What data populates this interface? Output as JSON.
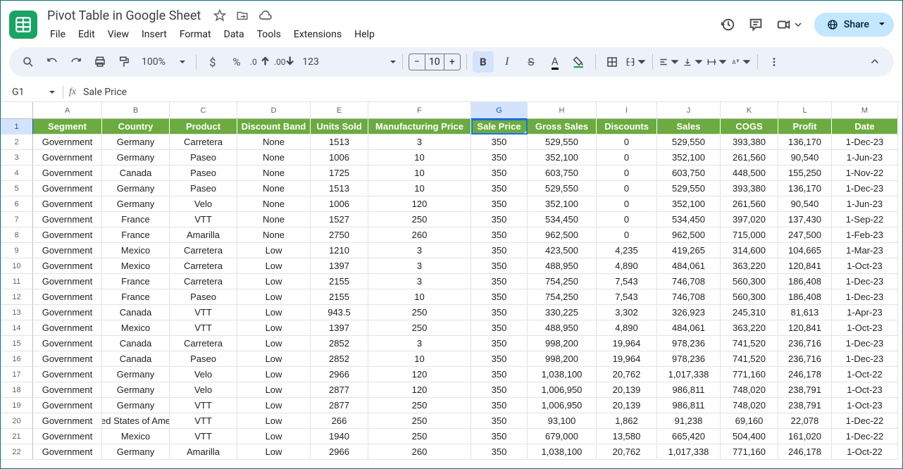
{
  "doc": {
    "title": "Pivot Table in Google Sheet"
  },
  "menus": [
    "File",
    "Edit",
    "View",
    "Insert",
    "Format",
    "Data",
    "Tools",
    "Extensions",
    "Help"
  ],
  "share_label": "Share",
  "zoom": "100%",
  "number_format": "123",
  "font_size": "10",
  "namebox": "G1",
  "formula": "Sale Price",
  "colLetters": [
    "A",
    "B",
    "C",
    "D",
    "E",
    "F",
    "G",
    "H",
    "I",
    "J",
    "K",
    "L",
    "M"
  ],
  "selectedCol": 6,
  "selectedRow": 0,
  "headers": [
    "Segment",
    "Country",
    "Product",
    "Discount Band",
    "Units Sold",
    "Manufacturing Price",
    "Sale Price",
    "Gross Sales",
    "Discounts",
    "Sales",
    "COGS",
    "Profit",
    "Date"
  ],
  "rows": [
    [
      "Government",
      "Germany",
      "Carretera",
      "None",
      "1513",
      "3",
      "350",
      "529,550",
      "0",
      "529,550",
      "393,380",
      "136,170",
      "1-Dec-23"
    ],
    [
      "Government",
      "Germany",
      "Paseo",
      "None",
      "1006",
      "10",
      "350",
      "352,100",
      "0",
      "352,100",
      "261,560",
      "90,540",
      "1-Jun-23"
    ],
    [
      "Government",
      "Canada",
      "Paseo",
      "None",
      "1725",
      "10",
      "350",
      "603,750",
      "0",
      "603,750",
      "448,500",
      "155,250",
      "1-Nov-22"
    ],
    [
      "Government",
      "Germany",
      "Paseo",
      "None",
      "1513",
      "10",
      "350",
      "529,550",
      "0",
      "529,550",
      "393,380",
      "136,170",
      "1-Dec-23"
    ],
    [
      "Government",
      "Germany",
      "Velo",
      "None",
      "1006",
      "120",
      "350",
      "352,100",
      "0",
      "352,100",
      "261,560",
      "90,540",
      "1-Jun-23"
    ],
    [
      "Government",
      "France",
      "VTT",
      "None",
      "1527",
      "250",
      "350",
      "534,450",
      "0",
      "534,450",
      "397,020",
      "137,430",
      "1-Sep-22"
    ],
    [
      "Government",
      "France",
      "Amarilla",
      "None",
      "2750",
      "260",
      "350",
      "962,500",
      "0",
      "962,500",
      "715,000",
      "247,500",
      "1-Feb-23"
    ],
    [
      "Government",
      "Mexico",
      "Carretera",
      "Low",
      "1210",
      "3",
      "350",
      "423,500",
      "4,235",
      "419,265",
      "314,600",
      "104,665",
      "1-Mar-23"
    ],
    [
      "Government",
      "Mexico",
      "Carretera",
      "Low",
      "1397",
      "3",
      "350",
      "488,950",
      "4,890",
      "484,061",
      "363,220",
      "120,841",
      "1-Oct-23"
    ],
    [
      "Government",
      "France",
      "Carretera",
      "Low",
      "2155",
      "3",
      "350",
      "754,250",
      "7,543",
      "746,708",
      "560,300",
      "186,408",
      "1-Dec-23"
    ],
    [
      "Government",
      "France",
      "Paseo",
      "Low",
      "2155",
      "10",
      "350",
      "754,250",
      "7,543",
      "746,708",
      "560,300",
      "186,408",
      "1-Dec-23"
    ],
    [
      "Government",
      "Canada",
      "VTT",
      "Low",
      "943.5",
      "250",
      "350",
      "330,225",
      "3,302",
      "326,923",
      "245,310",
      "81,613",
      "1-Apr-23"
    ],
    [
      "Government",
      "Mexico",
      "VTT",
      "Low",
      "1397",
      "250",
      "350",
      "488,950",
      "4,890",
      "484,061",
      "363,220",
      "120,841",
      "1-Oct-23"
    ],
    [
      "Government",
      "Canada",
      "Carretera",
      "Low",
      "2852",
      "3",
      "350",
      "998,200",
      "19,964",
      "978,236",
      "741,520",
      "236,716",
      "1-Dec-23"
    ],
    [
      "Government",
      "Canada",
      "Paseo",
      "Low",
      "2852",
      "10",
      "350",
      "998,200",
      "19,964",
      "978,236",
      "741,520",
      "236,716",
      "1-Dec-23"
    ],
    [
      "Government",
      "Germany",
      "Velo",
      "Low",
      "2966",
      "120",
      "350",
      "1,038,100",
      "20,762",
      "1,017,338",
      "771,160",
      "246,178",
      "1-Oct-22"
    ],
    [
      "Government",
      "Germany",
      "Velo",
      "Low",
      "2877",
      "120",
      "350",
      "1,006,950",
      "20,139",
      "986,811",
      "748,020",
      "238,791",
      "1-Oct-23"
    ],
    [
      "Government",
      "Germany",
      "VTT",
      "Low",
      "2877",
      "250",
      "350",
      "1,006,950",
      "20,139",
      "986,811",
      "748,020",
      "238,791",
      "1-Oct-23"
    ],
    [
      "Government",
      "ed States of Ame",
      "VTT",
      "Low",
      "266",
      "250",
      "350",
      "93,100",
      "1,862",
      "91,238",
      "69,160",
      "22,078",
      "1-Dec-22"
    ],
    [
      "Government",
      "Mexico",
      "VTT",
      "Low",
      "1940",
      "250",
      "350",
      "679,000",
      "13,580",
      "665,420",
      "504,400",
      "161,020",
      "1-Dec-22"
    ],
    [
      "Government",
      "Germany",
      "Amarilla",
      "Low",
      "2966",
      "260",
      "350",
      "1,038,100",
      "20,762",
      "1,017,338",
      "771,160",
      "246,178",
      "1-Oct-22"
    ]
  ]
}
